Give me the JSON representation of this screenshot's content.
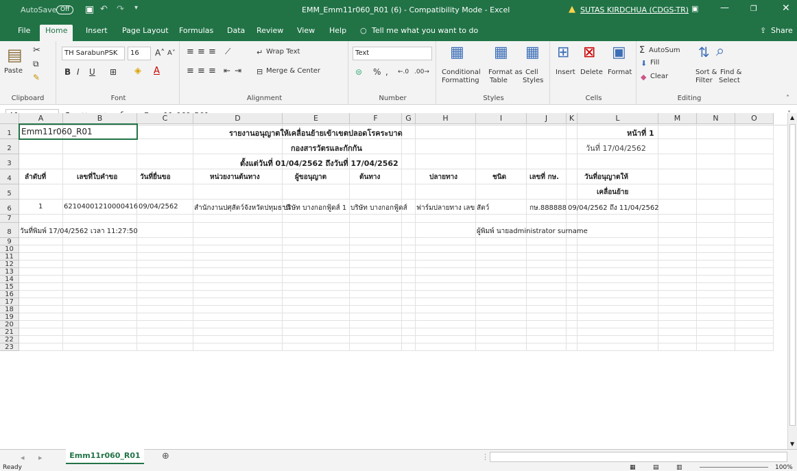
{
  "titlebar": {
    "autosave_label": "AutoSave",
    "autosave_state": "Off",
    "doc_title": "EMM_Emm11r060_R01 (6)  -  Compatibility Mode  -  Excel",
    "user": "SUTAS KIRDCHUA (CDGS-TR)"
  },
  "tabs": [
    "File",
    "Home",
    "Insert",
    "Page Layout",
    "Formulas",
    "Data",
    "Review",
    "View",
    "Help"
  ],
  "tell_me": "Tell me what you want to do",
  "share": "Share",
  "ribbon": {
    "clipboard": {
      "paste": "Paste",
      "label": "Clipboard"
    },
    "font": {
      "name": "TH SarabunPSK",
      "size": "16",
      "label": "Font",
      "bold": "B",
      "italic": "I",
      "underline": "U"
    },
    "alignment": {
      "wrap": "Wrap Text",
      "merge": "Merge & Center",
      "label": "Alignment"
    },
    "number": {
      "format": "Text",
      "percent": "%",
      "comma": ",",
      "label": "Number"
    },
    "styles": {
      "conditional": "Conditional",
      "conditional2": "Formatting",
      "format_as": "Format as",
      "format_as2": "Table",
      "cell": "Cell",
      "cell2": "Styles",
      "label": "Styles"
    },
    "cells": {
      "insert": "Insert",
      "delete": "Delete",
      "format": "Format",
      "label": "Cells"
    },
    "editing": {
      "autosum": "AutoSum",
      "fill": "Fill",
      "clear": "Clear",
      "sort": "Sort &",
      "sort2": "Filter",
      "find": "Find &",
      "find2": "Select",
      "label": "Editing"
    }
  },
  "formula_bar": {
    "name_box": "A1",
    "fx": "fx",
    "content": "Emm11r060_R01"
  },
  "columns": [
    "A",
    "B",
    "C",
    "D",
    "E",
    "F",
    "G",
    "H",
    "I",
    "J",
    "K",
    "L",
    "M",
    "N",
    "O"
  ],
  "rows": [
    "1",
    "2",
    "3",
    "4",
    "5",
    "6",
    "7",
    "8",
    "9",
    "10",
    "11",
    "12",
    "13",
    "14",
    "15",
    "16",
    "17",
    "18",
    "19",
    "20",
    "21",
    "22",
    "23"
  ],
  "sheet": {
    "a1": "Emm11r060_R01",
    "title": "รายงานอนุญาตให้เคลื่อนย้ายเข้าเขตปลอดโรคระบาด",
    "page": "หน้าที่ 1",
    "dept": "กองสารวัตรและกักกัน",
    "date": "วันที่ 17/04/2562",
    "range": "ตั้งแต่วันที่ 01/04/2562 ถึงวันที่ 17/04/2562",
    "headers": [
      "ลำดับที่",
      "เลขที่ใบคำขอ",
      "วันที่ยื่นขอ",
      "หน่วยงานต้นทาง",
      "ผู้ขอนุญาต",
      "ต้นทาง",
      "ปลายทาง",
      "ชนิด",
      "เลขที่ กษ.",
      "วันที่อนุญาตให้",
      "เคลื่อนย้าย"
    ],
    "row6": [
      "1",
      "62104001210000416",
      "09/04/2562",
      "สำนักงานปศุสัตว์จังหวัดปทุมธานี",
      "บริษัท บางกอกฟู้ดส์ 1",
      "บริษัท บางกอกฟู้ดส์",
      "ฟาร์มปลายทาง เลข",
      "สัตว์",
      "กษ.888888",
      "09/04/2562 ถึง 11/04/2562"
    ],
    "print_time": "วันที่พิมพ์  17/04/2562  เวลา  11:27:50",
    "printed_by": "ผู้พิมพ์ นายadministrator surname"
  },
  "sheet_tab": "Emm11r060_R01",
  "status": {
    "ready": "Ready",
    "zoom": "100%"
  }
}
